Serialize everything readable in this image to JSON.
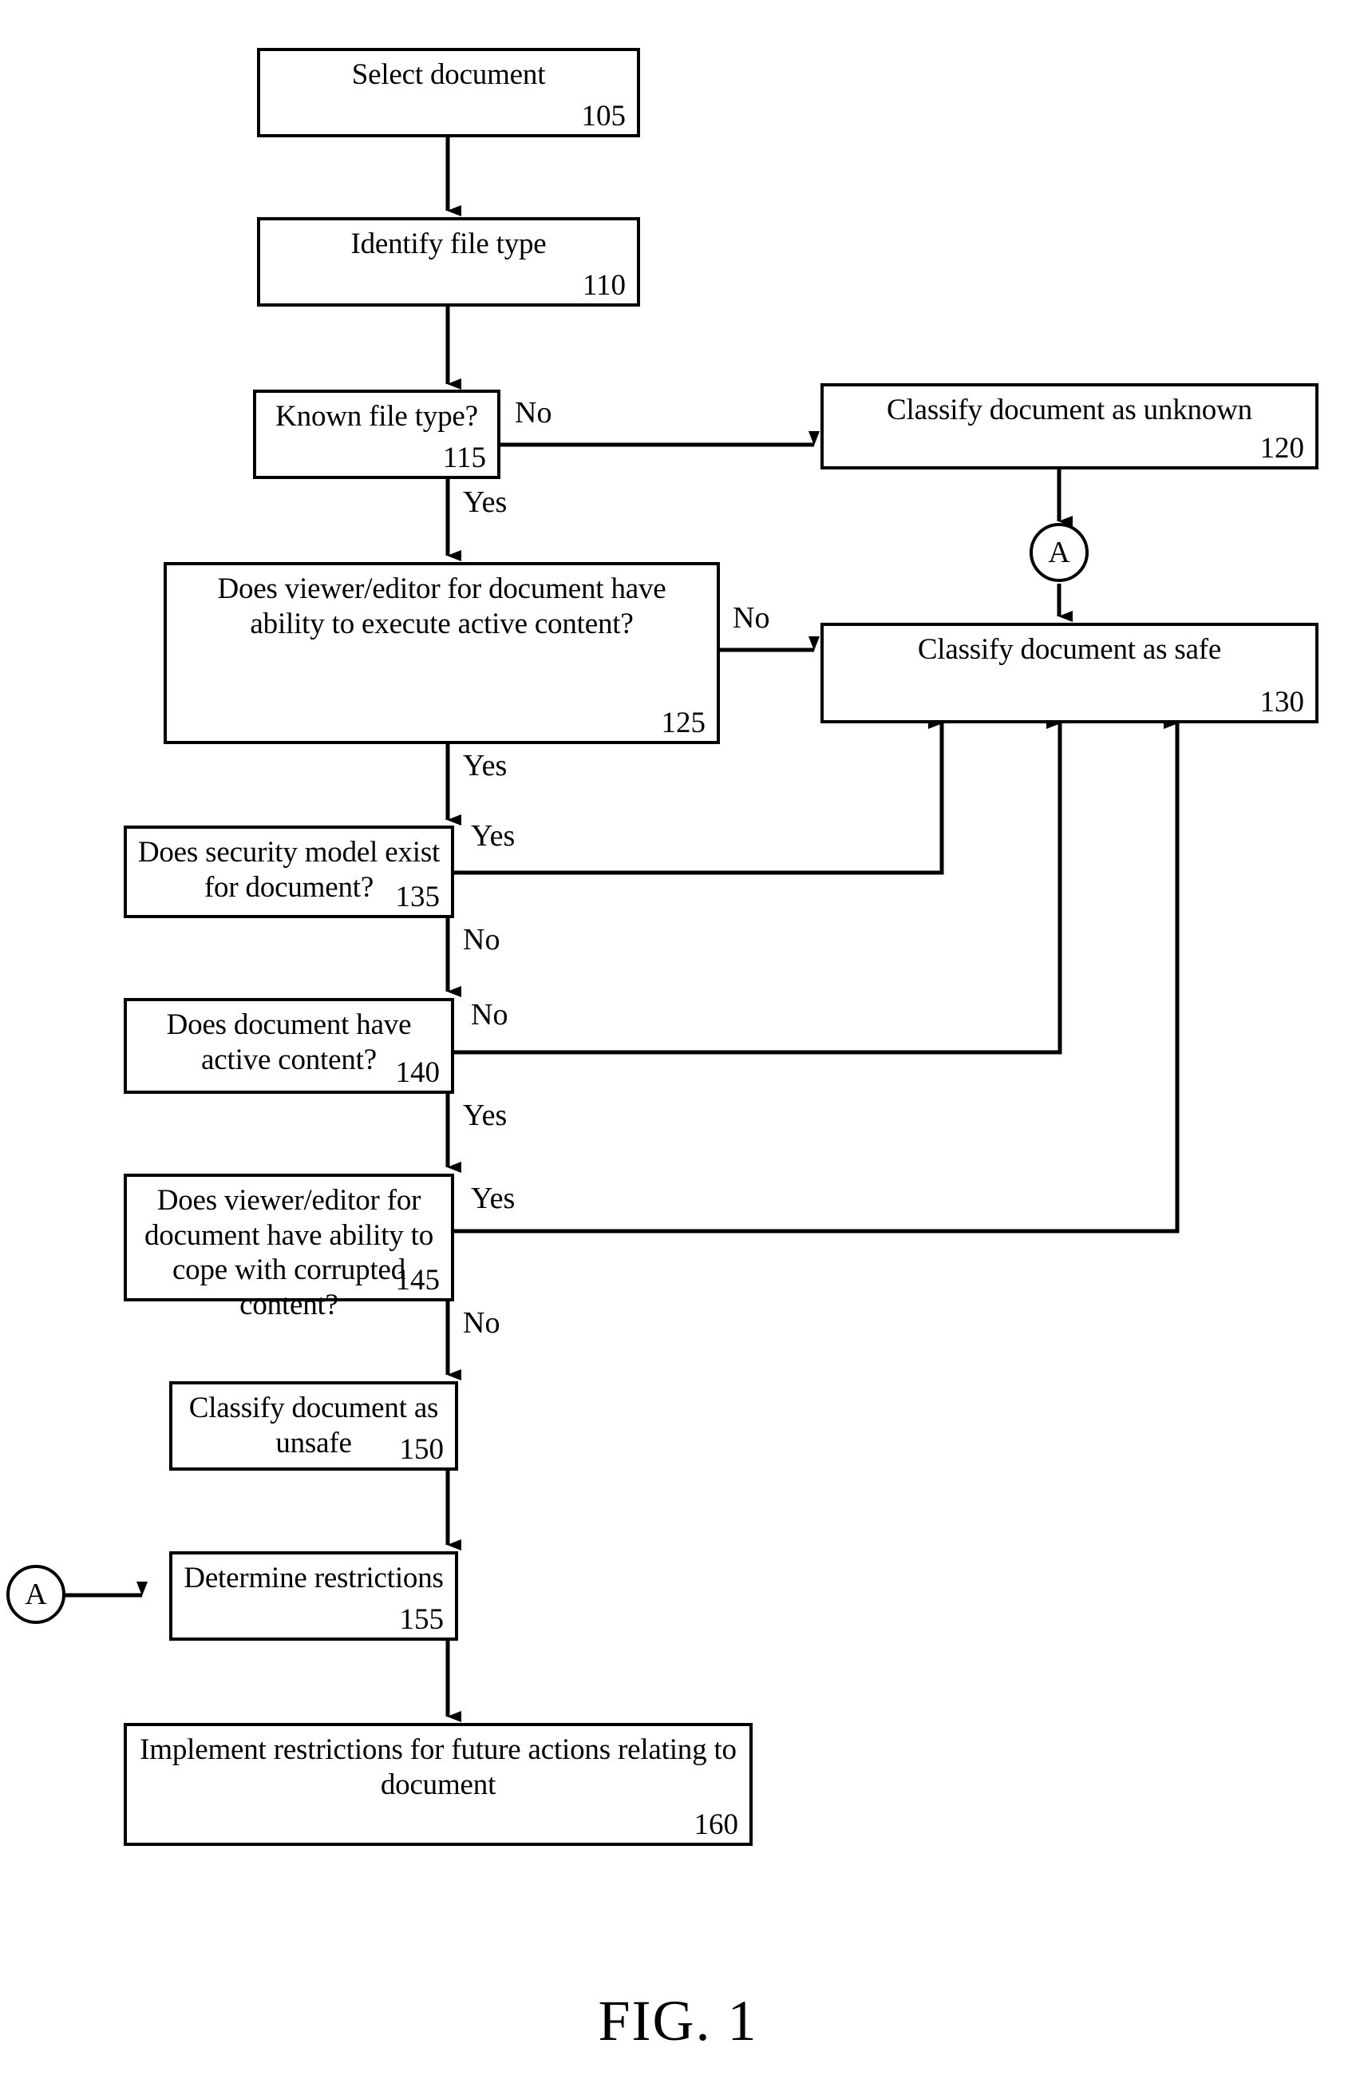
{
  "figure": {
    "caption": "FIG. 1"
  },
  "chart_data": {
    "type": "diagram",
    "title": "FIG. 1",
    "subtype": "flowchart",
    "nodes": [
      {
        "ref": "105",
        "text": "Select document",
        "shape": "rectangle",
        "kind": "process"
      },
      {
        "ref": "110",
        "text": "Identify file type",
        "shape": "rectangle",
        "kind": "process"
      },
      {
        "ref": "115",
        "text": "Known file type?",
        "shape": "rectangle",
        "kind": "decision"
      },
      {
        "ref": "120",
        "text": "Classify document as unknown",
        "shape": "rectangle",
        "kind": "process"
      },
      {
        "ref": "125",
        "text": "Does viewer/editor for document have ability to execute active content?",
        "shape": "rectangle",
        "kind": "decision"
      },
      {
        "ref": "130",
        "text": "Classify document as safe",
        "shape": "rectangle",
        "kind": "process"
      },
      {
        "ref": "135",
        "text": "Does security model exist for document?",
        "shape": "rectangle",
        "kind": "decision"
      },
      {
        "ref": "140",
        "text": "Does document have active content?",
        "shape": "rectangle",
        "kind": "decision"
      },
      {
        "ref": "145",
        "text": "Does viewer/editor for document have ability to cope with corrupted content?",
        "shape": "rectangle",
        "kind": "decision"
      },
      {
        "ref": "150",
        "text": "Classify document as unsafe",
        "shape": "rectangle",
        "kind": "process"
      },
      {
        "ref": "155",
        "text": "Determine restrictions",
        "shape": "rectangle",
        "kind": "process"
      },
      {
        "ref": "160",
        "text": "Implement restrictions for future actions relating to document",
        "shape": "rectangle",
        "kind": "process"
      }
    ],
    "connectors": [
      {
        "id": "A-top",
        "label": "A",
        "shape": "circle"
      },
      {
        "id": "A-bottom",
        "label": "A",
        "shape": "circle"
      }
    ],
    "edges": [
      {
        "from": "105",
        "to": "110",
        "label": ""
      },
      {
        "from": "110",
        "to": "115",
        "label": ""
      },
      {
        "from": "115",
        "to": "120",
        "label": "No"
      },
      {
        "from": "115",
        "to": "125",
        "label": "Yes"
      },
      {
        "from": "120",
        "to": "A-top",
        "label": ""
      },
      {
        "from": "125",
        "to": "130",
        "label": "No"
      },
      {
        "from": "125",
        "to": "135",
        "label": "Yes"
      },
      {
        "from": "130",
        "to": "A-top",
        "label": ""
      },
      {
        "from": "135",
        "to": "130",
        "label": "Yes"
      },
      {
        "from": "135",
        "to": "140",
        "label": "No"
      },
      {
        "from": "140",
        "to": "130",
        "label": "No"
      },
      {
        "from": "140",
        "to": "145",
        "label": "Yes"
      },
      {
        "from": "145",
        "to": "130",
        "label": "Yes"
      },
      {
        "from": "145",
        "to": "150",
        "label": "No"
      },
      {
        "from": "150",
        "to": "155",
        "label": ""
      },
      {
        "from": "A-bottom",
        "to": "155",
        "label": ""
      },
      {
        "from": "155",
        "to": "160",
        "label": ""
      }
    ]
  },
  "nodes": {
    "n105": {
      "text": "Select document",
      "ref": "105"
    },
    "n110": {
      "text": "Identify file type",
      "ref": "110"
    },
    "n115": {
      "text": "Known file type?",
      "ref": "115"
    },
    "n120": {
      "text": "Classify document as unknown",
      "ref": "120"
    },
    "n125": {
      "text": "Does viewer/editor for document have ability to execute active content?",
      "ref": "125"
    },
    "n130": {
      "text": "Classify document as safe",
      "ref": "130"
    },
    "n135": {
      "text": "Does security model exist for document?",
      "ref": "135"
    },
    "n140": {
      "text": "Does document have active content?",
      "ref": "140"
    },
    "n145": {
      "text": "Does viewer/editor for document have ability to cope with corrupted content?",
      "ref": "145"
    },
    "n150": {
      "text": "Classify document as unsafe",
      "ref": "150"
    },
    "n155": {
      "text": "Determine restrictions",
      "ref": "155"
    },
    "n160": {
      "text": "Implement restrictions for future actions relating to document",
      "ref": "160"
    }
  },
  "connectors": {
    "a_top": "A",
    "a_bottom": "A"
  },
  "edge_labels": {
    "no_115": "No",
    "yes_115": "Yes",
    "no_125": "No",
    "yes_125": "Yes",
    "yes_135": "Yes",
    "no_135": "No",
    "no_140": "No",
    "yes_140": "Yes",
    "yes_145": "Yes",
    "no_145": "No"
  },
  "colors": {
    "ink": "#000000",
    "paper": "#ffffff"
  }
}
